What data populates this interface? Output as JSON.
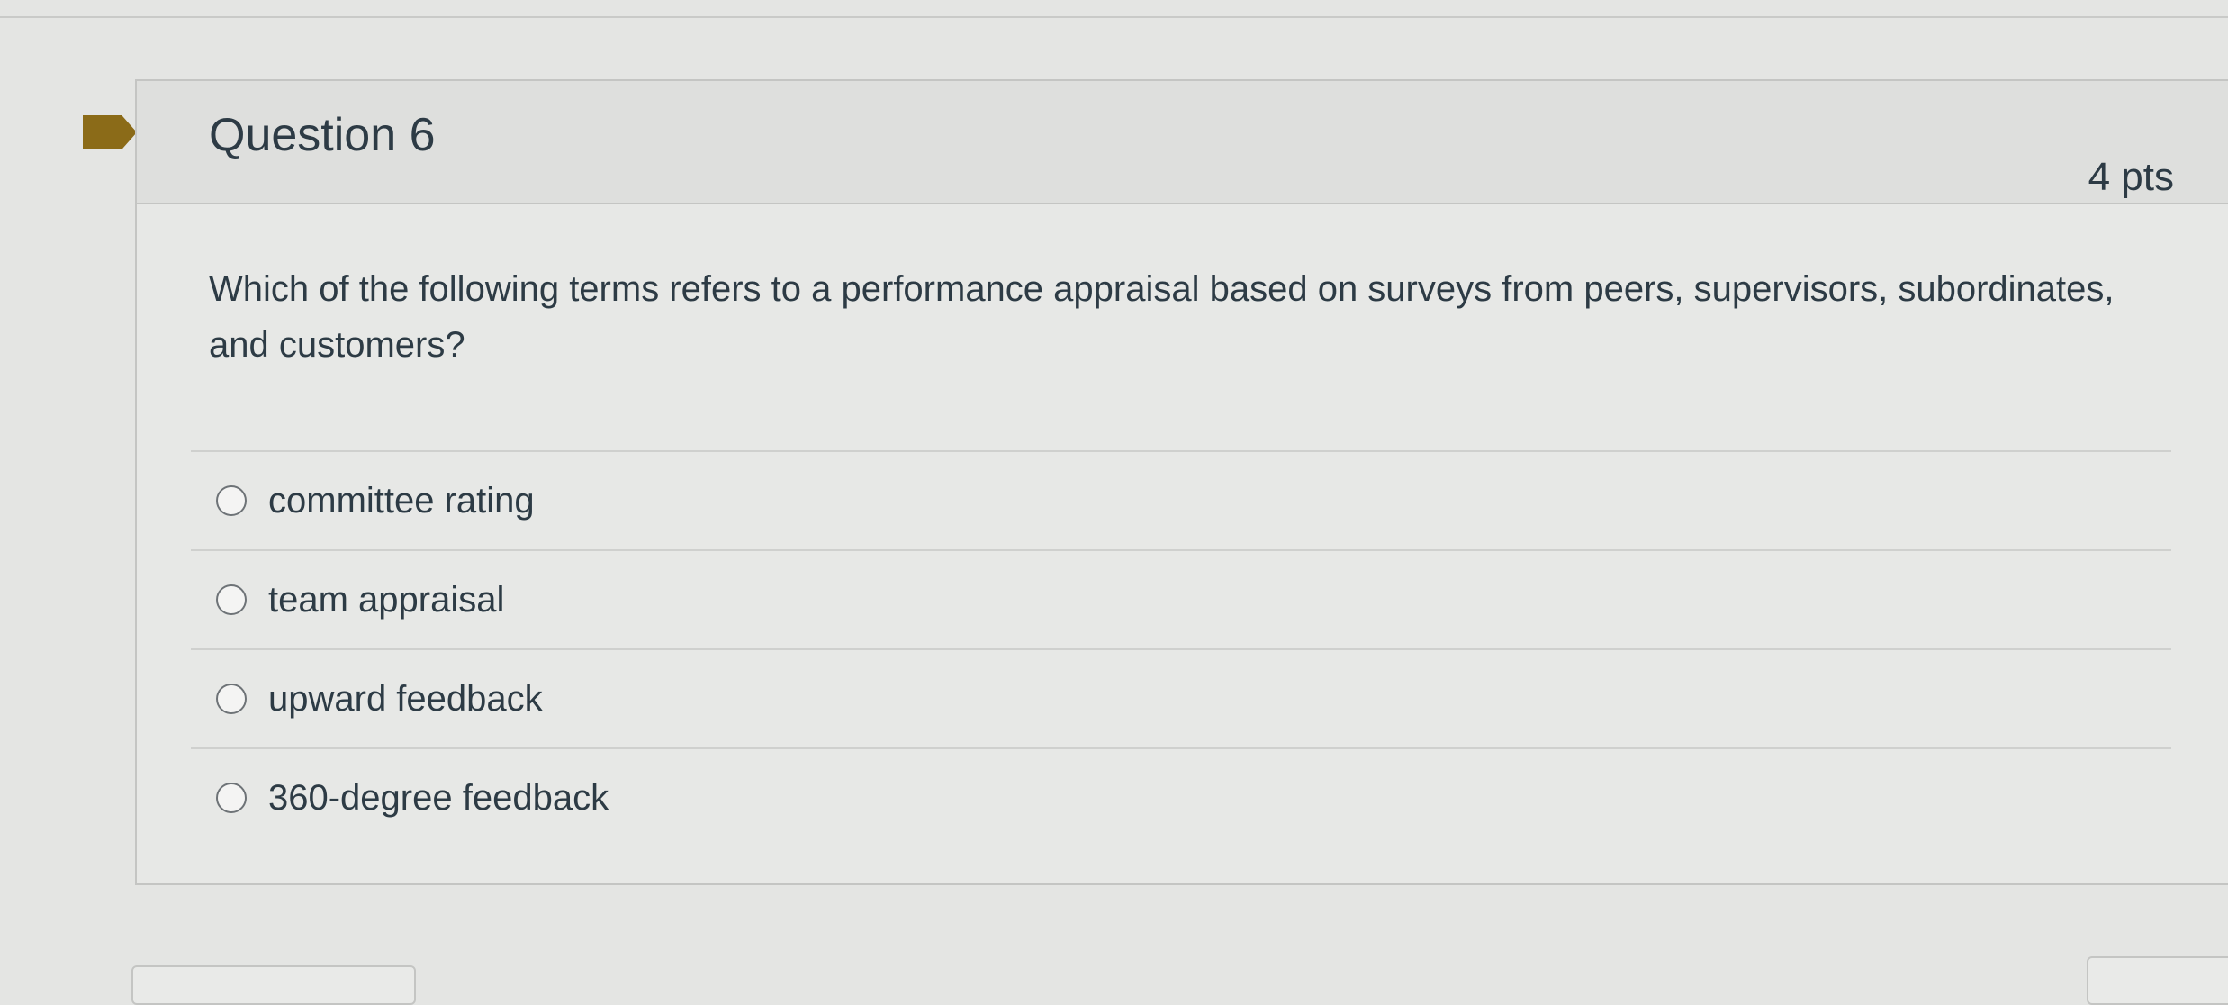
{
  "question": {
    "title": "Question 6",
    "points": "4 pts",
    "text": "Which of the following terms refers to a performance appraisal based on surveys from peers, supervisors, subordinates, and customers?",
    "answers": [
      {
        "label": "committee rating"
      },
      {
        "label": "team appraisal"
      },
      {
        "label": "upward feedback"
      },
      {
        "label": "360-degree feedback"
      }
    ]
  },
  "colors": {
    "flag": "#8b6b18",
    "text": "#2d3b45",
    "border": "#c4c5c3"
  }
}
